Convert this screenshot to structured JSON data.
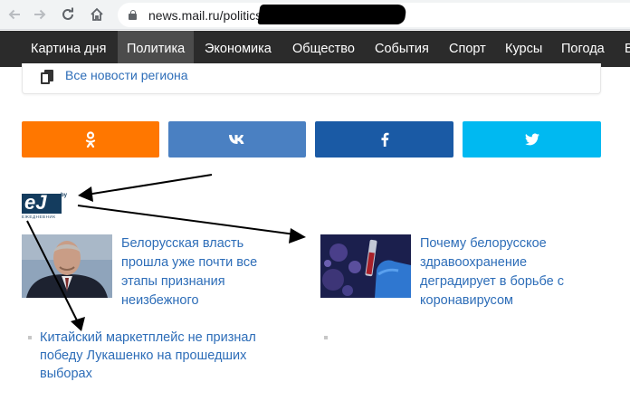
{
  "browser": {
    "url": "news.mail.ru/politics/",
    "back_icon": "arrow-left-icon",
    "forward_icon": "arrow-right-icon",
    "reload_icon": "reload-icon",
    "home_icon": "home-icon"
  },
  "nav": {
    "items": [
      "Картина дня",
      "Политика",
      "Экономика",
      "Общество",
      "События",
      "Спорт",
      "Курсы",
      "Погода",
      "В"
    ],
    "active": "Политика"
  },
  "region_card": {
    "icon": "document-copy-icon",
    "link_text": "Все новости региона"
  },
  "share": [
    {
      "network": "Одноклассники",
      "icon": "ok-icon",
      "color": "#ff7700"
    },
    {
      "network": "ВКонтакте",
      "icon": "vk-icon",
      "color": "#4a80c2"
    },
    {
      "network": "Facebook",
      "icon": "facebook-icon",
      "color": "#1a5aa5"
    },
    {
      "network": "Twitter",
      "icon": "twitter-icon",
      "color": "#00b9f1"
    }
  ],
  "source": {
    "logo_text": "eJ",
    "logo_suffix": "by",
    "logo_subtitle": "ЕЖЕДНЕВНИК"
  },
  "related": [
    {
      "title_lines": [
        "Белорусская власть",
        "прошла уже почти все",
        "этапы признания",
        "неизбежного"
      ]
    },
    {
      "title_lines": [
        "Почему белорусское",
        "здравоохранение",
        "деградирует в борьбе с",
        "коронавирусом"
      ]
    }
  ],
  "list": [
    {
      "text_lines": [
        "Китайский маркетплейс не признал",
        "победу Лукашенко на прошедших",
        "выборах"
      ]
    },
    {
      "text_lines": []
    }
  ],
  "colors": {
    "link": "#2d6db8",
    "nav_bg": "#2b2b2b",
    "nav_active_bg": "#4c4c4c"
  }
}
